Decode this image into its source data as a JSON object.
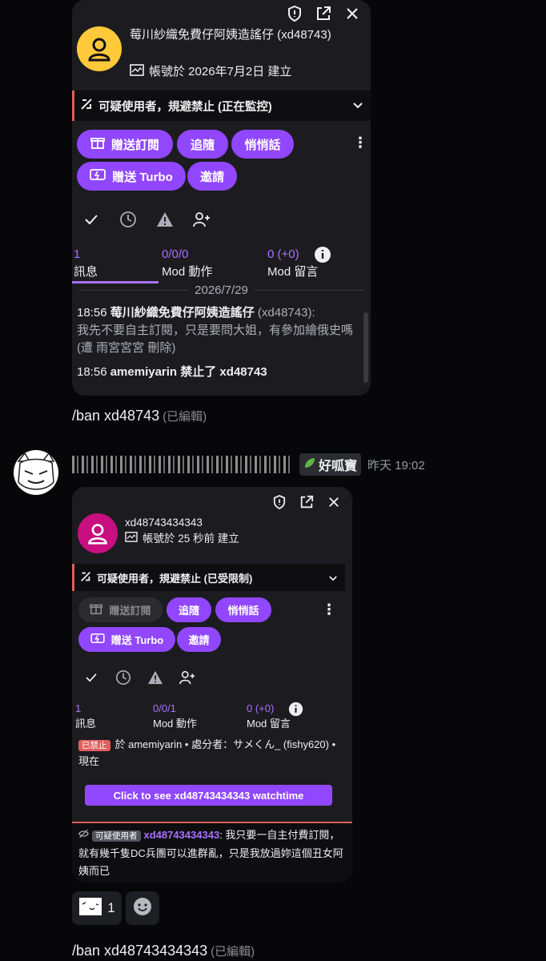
{
  "card1": {
    "username": "莓川紗織免費仔阿姨造謠仔 (xd48743)",
    "created": "帳號於 2026年7月2日 建立",
    "warning": "可疑使用者，規避禁止 (正在監控)",
    "buttons": {
      "gift_sub": "贈送訂閱",
      "follow": "追隨",
      "whisper": "悄悄話",
      "gift_turbo": "贈送 Turbo",
      "invite": "邀請"
    },
    "stats": {
      "messages_value": "1",
      "messages_label": "訊息",
      "mod_actions_value": "0/0/0",
      "mod_actions_label": "Mod 動作",
      "mod_comments_value": "0 (+0)",
      "mod_comments_label": "Mod 留言"
    },
    "date_divider": "2026/7/29",
    "log": {
      "line1_time": "18:56",
      "line1_user": "莓川紗織免費仔阿姨造謠仔",
      "line1_id": "(xd48743):",
      "line1_text": "我先不要自主訂閱，只是要問大姐，有參加繪俄史嗎 (遭 雨宮宮宮 刪除)",
      "line2_time": "18:56",
      "line2_text": "amemiyarin 禁止了 xd48743"
    }
  },
  "message1": {
    "text": "/ban xd48743",
    "edited": "(已編輯)"
  },
  "author": {
    "tag": "好呱寶",
    "time": "昨天 19:02"
  },
  "card2": {
    "username": "xd48743434343",
    "created": "帳號於 25 秒前 建立",
    "warning": "可疑使用者，規避禁止 (已受限制)",
    "buttons": {
      "gift_sub": "贈送訂閱",
      "follow": "追隨",
      "whisper": "悄悄話",
      "gift_turbo": "贈送 Turbo",
      "invite": "邀請"
    },
    "stats": {
      "messages_value": "1",
      "messages_label": "訊息",
      "mod_actions_value": "0/0/1",
      "mod_actions_label": "Mod 動作",
      "mod_comments_value": "0 (+0)",
      "mod_comments_label": "Mod 留言"
    },
    "ban": {
      "badge": "已禁止",
      "text": "於 amemiyarin • 處分者：サメくん_ (fishy620) • 現在"
    },
    "watchtime_button": "Click to see xd48743434343 watchtime",
    "last_message": {
      "badge": "可疑使用者",
      "user": "xd48743434343",
      "text": ": 我只要一自主付費訂閱，就有幾千隻DC兵團可以進群亂，只是我放過妳這個丑女阿姨而已"
    }
  },
  "reactions": {
    "count": "1"
  },
  "message2": {
    "text": "/ban xd48743434343",
    "edited": "(已編輯)"
  }
}
